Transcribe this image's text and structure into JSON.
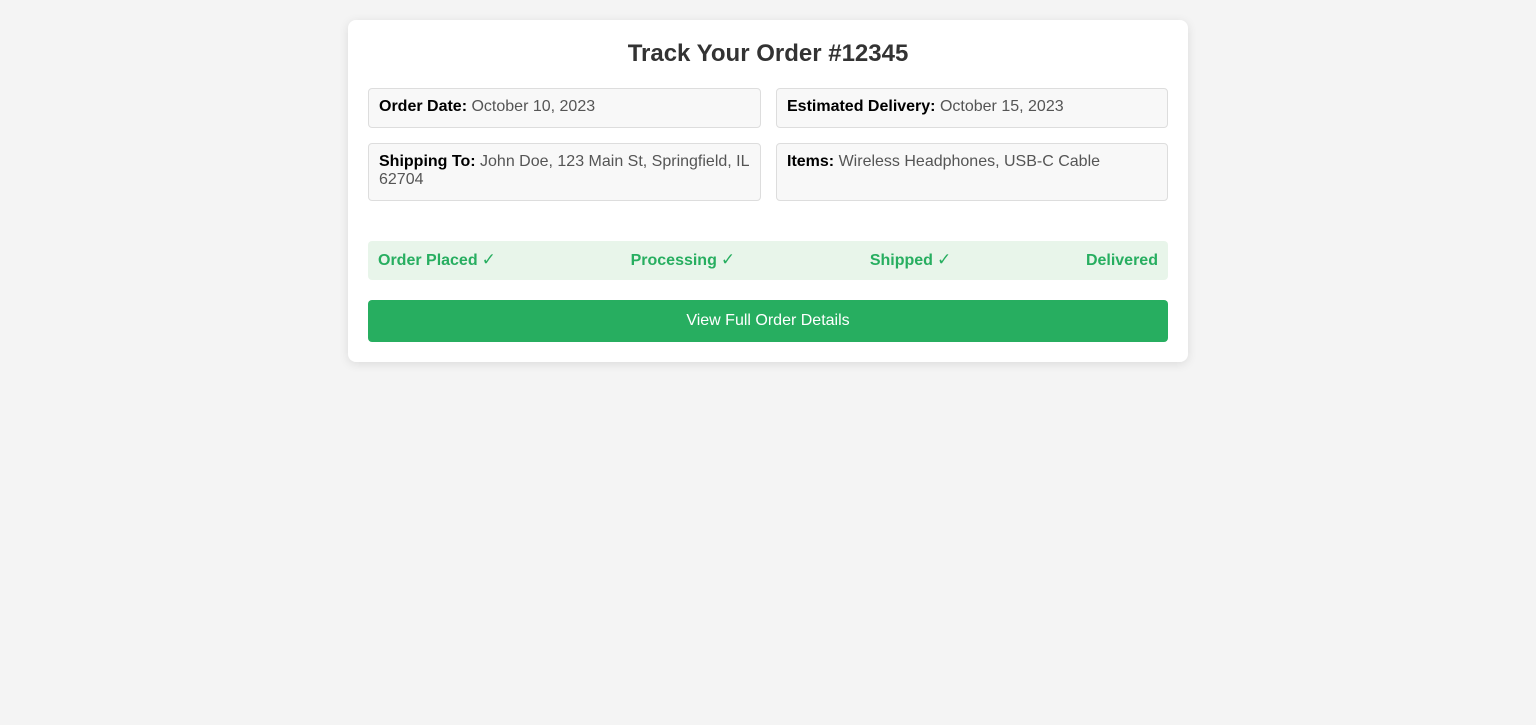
{
  "page": {
    "title": "Track Your Order #12345"
  },
  "order_info": {
    "order_date": {
      "label": "Order Date:",
      "value": "October 10, 2023"
    },
    "estimated_delivery": {
      "label": "Estimated Delivery:",
      "value": "October 15, 2023"
    },
    "shipping_to": {
      "label": "Shipping To:",
      "value": "John Doe, 123 Main St, Springfield, IL 62704"
    },
    "items": {
      "label": "Items:",
      "value": "Wireless Headphones, USB-C Cable"
    }
  },
  "progress": {
    "steps": [
      {
        "label": "Order Placed",
        "completed": true,
        "check": "✓"
      },
      {
        "label": "Processing",
        "completed": true,
        "check": "✓"
      },
      {
        "label": "Shipped",
        "completed": true,
        "check": "✓"
      },
      {
        "label": "Delivered",
        "completed": false,
        "check": ""
      }
    ]
  },
  "actions": {
    "view_details_label": "View Full Order Details"
  },
  "colors": {
    "accent": "#27ae60",
    "progress_bg": "#e8f5ea",
    "page_bg": "#f4f4f4",
    "card_bg": "#ffffff"
  }
}
